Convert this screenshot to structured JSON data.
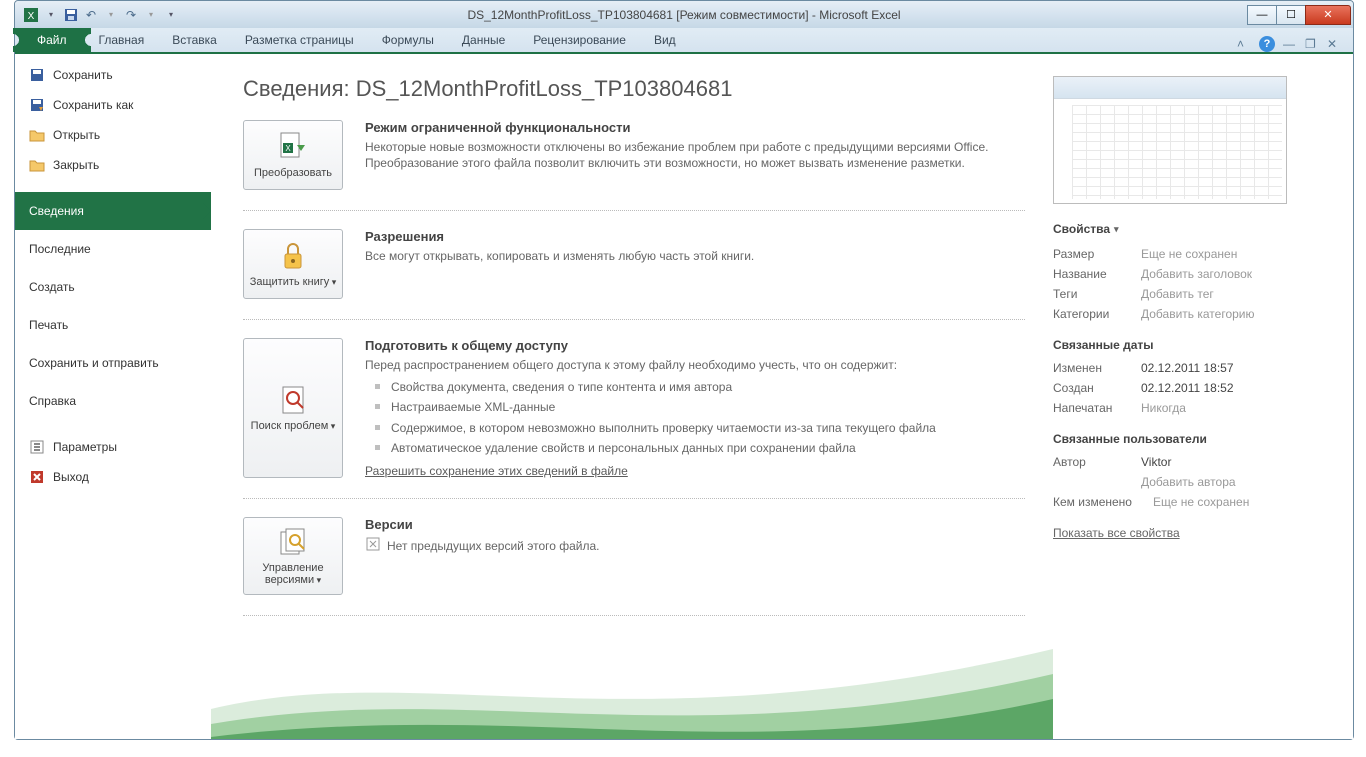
{
  "window": {
    "title": "DS_12MonthProfitLoss_TP103804681  [Режим совместимости]  -  Microsoft Excel"
  },
  "ribbon": {
    "file": "Файл",
    "tabs": [
      "Главная",
      "Вставка",
      "Разметка страницы",
      "Формулы",
      "Данные",
      "Рецензирование",
      "Вид"
    ]
  },
  "nav": {
    "save": "Сохранить",
    "saveAs": "Сохранить как",
    "open": "Открыть",
    "close": "Закрыть",
    "info": "Сведения",
    "recent": "Последние",
    "new": "Создать",
    "print": "Печать",
    "saveSend": "Сохранить и отправить",
    "help": "Справка",
    "options": "Параметры",
    "exit": "Выход"
  },
  "main": {
    "title": "Сведения: DS_12MonthProfitLoss_TP103804681",
    "compat": {
      "btn": "Преобразовать",
      "h": "Режим ограниченной функциональности",
      "p": "Некоторые новые возможности отключены во избежание проблем при работе с предыдущими версиями Office. Преобразование этого файла позволит включить эти возможности, но может вызвать изменение разметки."
    },
    "perm": {
      "btn": "Защитить книгу",
      "h": "Разрешения",
      "p": "Все могут открывать, копировать и изменять любую часть этой книги."
    },
    "prepare": {
      "btn": "Поиск проблем",
      "h": "Подготовить к общему доступу",
      "intro": "Перед распространением общего доступа к этому файлу необходимо учесть, что он содержит:",
      "items": [
        "Свойства документа, сведения о типе контента и имя автора",
        "Настраиваемые XML-данные",
        "Содержимое, в котором невозможно выполнить проверку читаемости из-за типа текущего файла",
        "Автоматическое удаление свойств и персональных данных при сохранении файла"
      ],
      "link": "Разрешить сохранение этих сведений в файле"
    },
    "versions": {
      "btn": "Управление версиями",
      "h": "Версии",
      "p": "Нет предыдущих версий этого файла."
    }
  },
  "props": {
    "hdr": "Свойства",
    "rows": {
      "size_k": "Размер",
      "size_v": "Еще не сохранен",
      "title_k": "Название",
      "title_v": "Добавить заголовок",
      "tags_k": "Теги",
      "tags_v": "Добавить тег",
      "cat_k": "Категории",
      "cat_v": "Добавить категорию"
    },
    "dates": {
      "hdr": "Связанные даты",
      "mod_k": "Изменен",
      "mod_v": "02.12.2011 18:57",
      "created_k": "Создан",
      "created_v": "02.12.2011 18:52",
      "printed_k": "Напечатан",
      "printed_v": "Никогда"
    },
    "people": {
      "hdr": "Связанные пользователи",
      "author_k": "Автор",
      "author_v": "Viktor",
      "addAuthor": "Добавить автора",
      "modby_k": "Кем изменено",
      "modby_v": "Еще не сохранен"
    },
    "showAll": "Показать все свойства"
  }
}
